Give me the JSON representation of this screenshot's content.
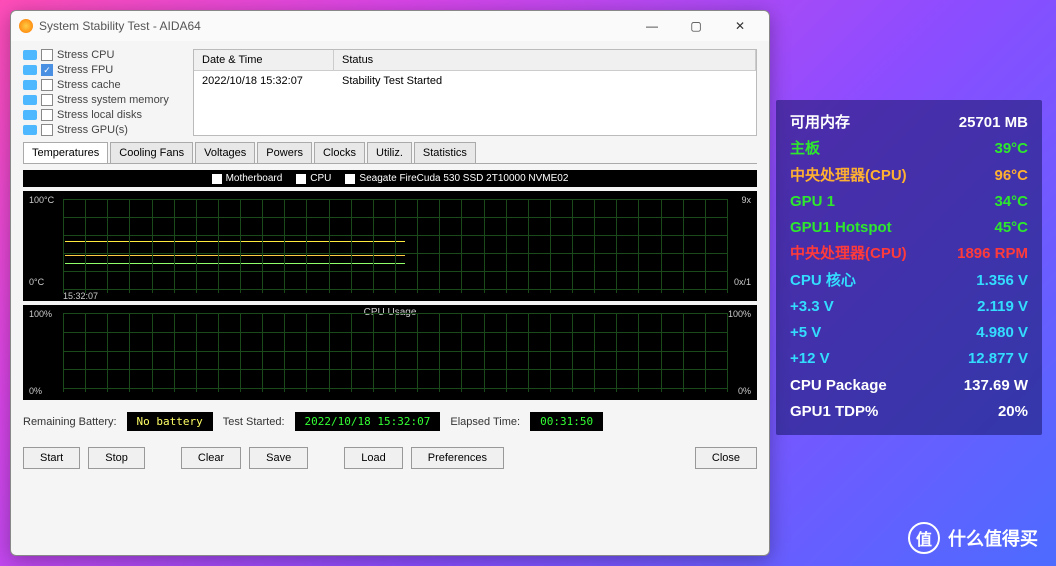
{
  "window": {
    "title": "System Stability Test - AIDA64",
    "controls": {
      "min": "—",
      "max": "▢",
      "close": "✕"
    }
  },
  "stress": {
    "items": [
      {
        "label": "Stress CPU",
        "checked": false
      },
      {
        "label": "Stress FPU",
        "checked": true
      },
      {
        "label": "Stress cache",
        "checked": false
      },
      {
        "label": "Stress system memory",
        "checked": false
      },
      {
        "label": "Stress local disks",
        "checked": false
      },
      {
        "label": "Stress GPU(s)",
        "checked": false
      }
    ]
  },
  "log": {
    "headers": {
      "c1": "Date & Time",
      "c2": "Status"
    },
    "rows": [
      {
        "c1": "2022/10/18 15:32:07",
        "c2": "Stability Test Started"
      }
    ]
  },
  "tabs": [
    "Temperatures",
    "Cooling Fans",
    "Voltages",
    "Powers",
    "Clocks",
    "Utiliz.",
    "Statistics"
  ],
  "activeTab": 0,
  "chart1": {
    "legend": [
      "Motherboard",
      "CPU",
      "Seagate FireCuda 530 SSD 2T10000 NVME02"
    ],
    "ylabels": {
      "top": "100°C",
      "bottom": "0°C",
      "right_top": "9x",
      "right_bot": "0x/1"
    },
    "xlabel": "15:32:07"
  },
  "chart2": {
    "title": "CPU Usage",
    "ylabels": {
      "top": "100%",
      "bottom": "0%",
      "right_top": "100%",
      "right_bot": "0%"
    }
  },
  "status": {
    "battery_label": "Remaining Battery:",
    "battery_val": "No battery",
    "started_label": "Test Started:",
    "started_val": "2022/10/18 15:32:07",
    "elapsed_label": "Elapsed Time:",
    "elapsed_val": "00:31:50"
  },
  "buttons": {
    "start": "Start",
    "stop": "Stop",
    "clear": "Clear",
    "save": "Save",
    "load": "Load",
    "prefs": "Preferences",
    "close": "Close"
  },
  "overlay": {
    "rows": [
      {
        "label": "可用内存",
        "value": "25701 MB",
        "lc": "c-white",
        "vc": "c-white"
      },
      {
        "label": "主板",
        "value": "39°C",
        "lc": "c-green",
        "vc": "c-green"
      },
      {
        "label": "中央处理器(CPU)",
        "value": "96°C",
        "lc": "c-orange",
        "vc": "c-orange"
      },
      {
        "label": "GPU 1",
        "value": "34°C",
        "lc": "c-green",
        "vc": "c-green"
      },
      {
        "label": "GPU1 Hotspot",
        "value": "45°C",
        "lc": "c-green",
        "vc": "c-green"
      },
      {
        "label": "中央处理器(CPU)",
        "value": "1896 RPM",
        "lc": "c-red",
        "vc": "c-red"
      },
      {
        "label": "CPU 核心",
        "value": "1.356 V",
        "lc": "c-cyan",
        "vc": "c-cyan"
      },
      {
        "label": "+3.3 V",
        "value": "2.119 V",
        "lc": "c-cyan",
        "vc": "c-cyan"
      },
      {
        "label": "+5 V",
        "value": "4.980 V",
        "lc": "c-cyan",
        "vc": "c-cyan"
      },
      {
        "label": "+12 V",
        "value": "12.877 V",
        "lc": "c-cyan",
        "vc": "c-cyan"
      },
      {
        "label": "CPU Package",
        "value": "137.69 W",
        "lc": "c-white",
        "vc": "c-white"
      },
      {
        "label": "GPU1 TDP%",
        "value": "20%",
        "lc": "c-white",
        "vc": "c-white"
      }
    ]
  },
  "watermark": {
    "circle": "值",
    "text": "什么值得买"
  },
  "chart_data": [
    {
      "type": "line",
      "title": "Temperatures",
      "ylabel": "°C",
      "ylim": [
        0,
        100
      ],
      "series": [
        {
          "name": "Motherboard",
          "approx_value": 40
        },
        {
          "name": "CPU",
          "approx_value": 96
        },
        {
          "name": "Seagate FireCuda 530 SSD",
          "approx_value": 48
        }
      ]
    },
    {
      "type": "line",
      "title": "CPU Usage",
      "ylabel": "%",
      "ylim": [
        0,
        100
      ],
      "series": [
        {
          "name": "CPU Usage",
          "approx_value": 0
        }
      ]
    }
  ]
}
